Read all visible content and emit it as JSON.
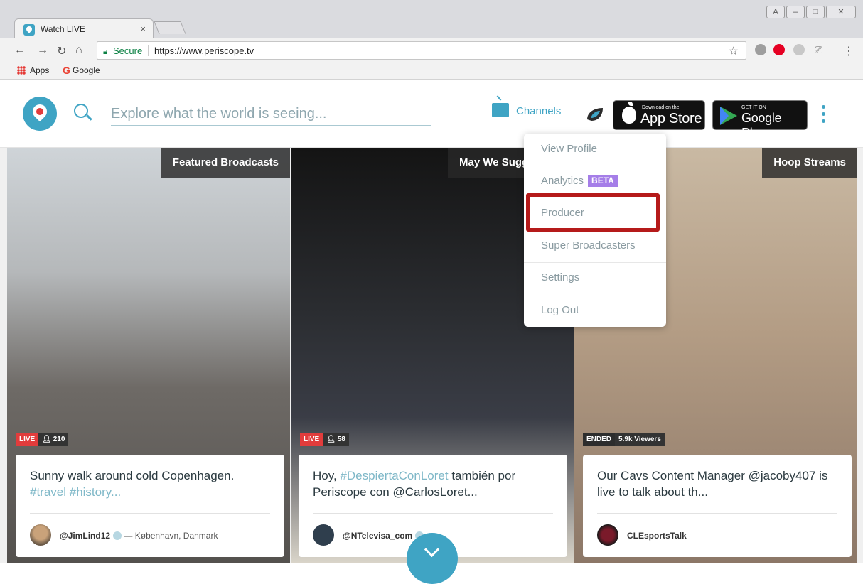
{
  "browser": {
    "tab_title": "Watch LIVE",
    "secure_label": "Secure",
    "url": "https://www.periscope.tv",
    "bookmarks": [
      "Apps",
      "Google"
    ]
  },
  "header": {
    "search_placeholder": "Explore what the world is seeing...",
    "channels_label": "Channels",
    "app_store": {
      "small": "Download on the",
      "big": "App Store"
    },
    "google_play": {
      "small": "GET IT ON",
      "big": "Google Play"
    }
  },
  "menu": {
    "items": [
      "View Profile",
      "Analytics",
      "Producer",
      "Super Broadcasters",
      "Settings",
      "Log Out"
    ],
    "beta_badge": "BETA"
  },
  "broadcasts": [
    {
      "section": "Featured Broadcasts",
      "status": "LIVE",
      "viewers": "210",
      "text": "Sunny walk around cold Copenhagen.",
      "tags": "#travel #history...",
      "user": "@JimLind12",
      "location": "— København, Danmark"
    },
    {
      "section": "May We Sugg",
      "status": "LIVE",
      "viewers": "58",
      "text_a": "Hoy,",
      "tag": "#DespiertaConLoret",
      "text_b": "también por Periscope con @CarlosLoret...",
      "user": "@NTelevisa_com"
    },
    {
      "section": "Hoop Streams",
      "status": "ENDED",
      "viewers": "5.9k Viewers",
      "text": "Our Cavs Content Manager @jacoby407 is live to talk about th...",
      "user": "CLEsportsTalk"
    }
  ],
  "colors": {
    "brand": "#3fa4c4",
    "live": "#e23c3c",
    "highlight": "#b51a1a",
    "beta": "#a57ee8"
  }
}
